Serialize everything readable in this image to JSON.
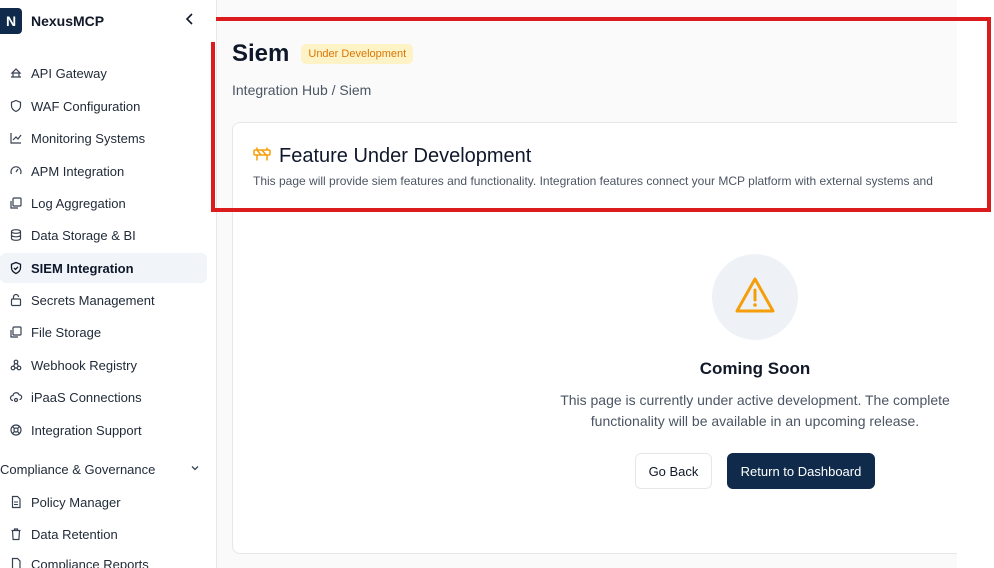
{
  "brand": {
    "logo_letter": "N",
    "name": "NexusMCP"
  },
  "sidebar": {
    "items": [
      {
        "label": "API Gateway",
        "icon": "gateway-icon"
      },
      {
        "label": "WAF Configuration",
        "icon": "shield-icon"
      },
      {
        "label": "Monitoring Systems",
        "icon": "line-chart-icon"
      },
      {
        "label": "APM Integration",
        "icon": "gauge-icon"
      },
      {
        "label": "Log Aggregation",
        "icon": "copy-icon"
      },
      {
        "label": "Data Storage & BI",
        "icon": "database-icon"
      },
      {
        "label": "SIEM Integration",
        "icon": "shield-check-icon",
        "active": true
      },
      {
        "label": "Secrets Management",
        "icon": "lock-icon"
      },
      {
        "label": "File Storage",
        "icon": "files-icon"
      },
      {
        "label": "Webhook Registry",
        "icon": "webhook-icon"
      },
      {
        "label": "iPaaS Connections",
        "icon": "cloud-link-icon"
      },
      {
        "label": "Integration Support",
        "icon": "lifebuoy-icon"
      }
    ],
    "section": {
      "label": "Compliance & Governance"
    },
    "section_items": [
      {
        "label": "Policy Manager",
        "icon": "document-icon"
      },
      {
        "label": "Data Retention",
        "icon": "trash-icon"
      },
      {
        "label": "Compliance Reports",
        "icon": "report-icon"
      }
    ]
  },
  "page": {
    "title": "Siem",
    "badge": "Under Development",
    "breadcrumb": "Integration Hub / Siem"
  },
  "card": {
    "title": "Feature Under Development",
    "description": "This page will provide siem features and functionality. Integration features connect your MCP platform with external systems and",
    "coming_title": "Coming Soon",
    "coming_desc": "This page is currently under active development. The complete functionality will be available in an upcoming release.",
    "back_label": "Go Back",
    "dashboard_label": "Return to Dashboard"
  },
  "colors": {
    "accent": "#0f2a4a",
    "warning": "#f59e0b",
    "highlight": "#dc1c1c"
  }
}
